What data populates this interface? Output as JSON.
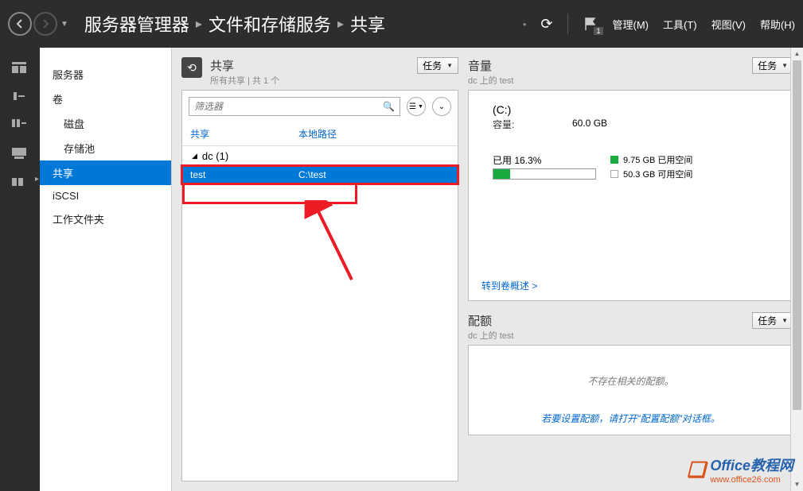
{
  "breadcrumb": {
    "p1": "服务器管理器",
    "p2": "文件和存储服务",
    "p3": "共享",
    "dot": "•"
  },
  "menus": {
    "manage": "管理(M)",
    "tools": "工具(T)",
    "view": "视图(V)",
    "help": "帮助(H)"
  },
  "flag_count": "1",
  "nav": {
    "servers": "服务器",
    "volumes": "卷",
    "disks": "磁盘",
    "pools": "存储池",
    "shares": "共享",
    "iscsi": "iSCSI",
    "workfolders": "工作文件夹"
  },
  "share_panel": {
    "title": "共享",
    "subtitle": "所有共享 | 共 1 个",
    "tasks": "任务",
    "filter_placeholder": "筛选器",
    "col_share": "共享",
    "col_path": "本地路径",
    "group": "dc (1)",
    "row": {
      "name": "test",
      "path": "C:\\test"
    }
  },
  "volume_panel": {
    "title": "音量",
    "subtitle": "dc 上的 test",
    "tasks": "任务",
    "drive": "(C:)",
    "capacity_label": "容量:",
    "capacity_value": "60.0 GB",
    "used_label": "已用 16.3%",
    "used_pct": 16.3,
    "legend_used": "9.75 GB 已用空间",
    "legend_free": "50.3 GB 可用空间",
    "link": "转到卷概述 >"
  },
  "quota_panel": {
    "title": "配额",
    "subtitle": "dc 上的 test",
    "tasks": "任务",
    "msg": "不存在相关的配额。",
    "hint": "若要设置配额，请打开\"配置配额\"对话框。"
  },
  "watermark": {
    "brand": "Office",
    "suffix": "教程网",
    "url": "www.office26.com"
  }
}
